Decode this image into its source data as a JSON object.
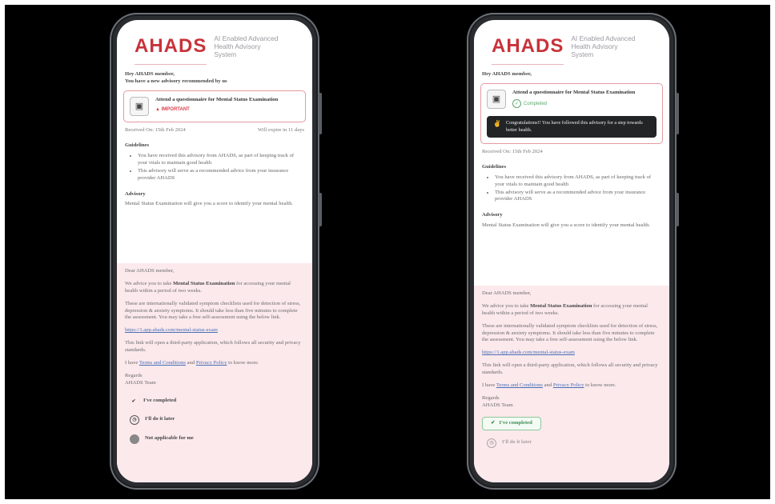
{
  "brand": {
    "logo": "AHADS",
    "tagline": "AI Enabled Advanced Health Advisory System"
  },
  "left": {
    "greeting_line1": "Hey AHADS member,",
    "greeting_line2": "You have a new advisory recommended by us",
    "card": {
      "title": "Attend a questionnaire for Mental Status Examination",
      "status": "IMPORTANT"
    },
    "received": "Received On: 15th Feb 2024",
    "expires": "Will expire in 11 days",
    "guidelines_title": "Guidelines",
    "guidelines": [
      "You have received this advisory from AHADS, as part of keeping track of your vitals to maintain good health",
      "This advisory will serve as a recommended advice from your insurance provider AHADS"
    ],
    "advisory_title": "Advisory",
    "advisory_text": "Mental Status Examination will give you a score to identify your mental health.",
    "letter": {
      "salutation": "Dear AHADS member,",
      "p1_pre": "We advice you to take ",
      "p1_bold": "Mental Status Examination",
      "p1_post": " for accessing your mental health within a period of two weeks.",
      "p2": "These are internationally validated symptom checklists used for detection of stress, depression & anxiety symptoms. It should take less than five minutes to complete the assessment. You may take a free self-assessment using the below link.",
      "link": "https://1.app.ahads.com/mental-status-exam",
      "p3": "This link will open a third-party application, which follows all security and privacy standards.",
      "p4_pre": "I have ",
      "p4_link1": "Terms and Conditions",
      "p4_mid": " and ",
      "p4_link2": "Privacy Policy",
      "p4_post": " to know more.",
      "regards": "Regards",
      "team": "AHADS Team"
    },
    "options": [
      "I've completed",
      "I'll do it later",
      "Not applicable for me"
    ]
  },
  "right": {
    "greeting_line1": "Hey AHADS member,",
    "card": {
      "title": "Attend a questionnaire for Mental Status Examination",
      "status": "Completed",
      "congrats": "Congratulations!! You have followed this advisory for a step towards better health."
    },
    "received": "Received On: 15th Feb 2024",
    "guidelines_title": "Guidelines",
    "guidelines": [
      "You have received this advisory from AHADS, as part of keeping track of your vitals to maintain good health",
      "This advisory will serve as a recommended advice from your insurance provider AHADS"
    ],
    "advisory_title": "Advisory",
    "advisory_text": "Mental Status Examination will give you a score to identify your mental health.",
    "letter": {
      "salutation": "Dear AHADS member,",
      "p1_pre": "We advice you to take ",
      "p1_bold": "Mental Status Examination",
      "p1_post": " for accessing your mental health within a period of two weeks.",
      "p2": "These are internationally validated symptom checklists used for detection of stress, depression & anxiety symptoms. It should take less than five minutes to complete the assessment. You may take a free self-assessment using the below link.",
      "link": "https://1.app.ahads.com/mental-status-exam",
      "p3": "This link will open a third-party application, which follows all security and privacy standards.",
      "p4_pre": "I have ",
      "p4_link1": "Terms and Conditions",
      "p4_mid": " and ",
      "p4_link2": "Privacy Policy",
      "p4_post": " to know more.",
      "regards": "Regards",
      "team": "AHADS Team"
    },
    "options": [
      "I've completed",
      "I'll do it later"
    ]
  },
  "colors": {
    "brand_red": "#c8323a",
    "card_border": "#e59aa0",
    "pink_bg": "#fbe9ec",
    "completed_green": "#3d8a50"
  }
}
